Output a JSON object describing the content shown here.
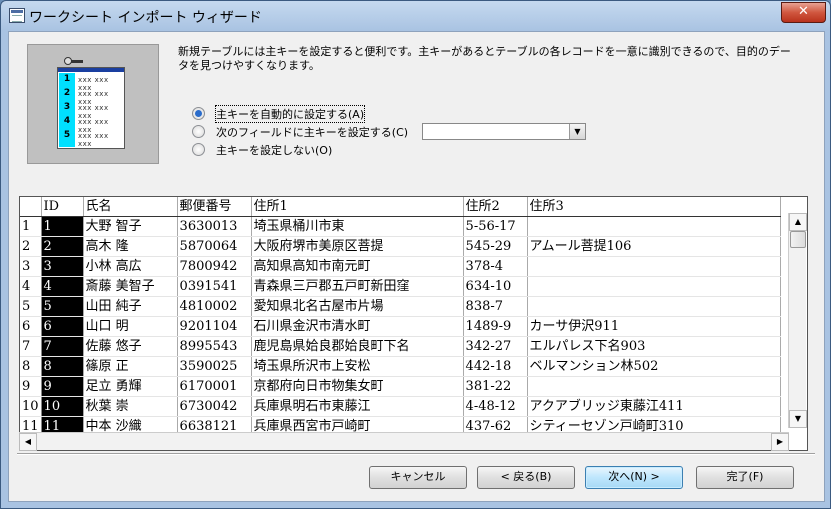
{
  "window": {
    "title": "ワークシート インポート ウィザード",
    "close_glyph": "✕"
  },
  "illustration": {
    "rows": [
      "1",
      "2",
      "3",
      "4",
      "5"
    ],
    "placeholder": "xxx xxx xxx"
  },
  "description": "新規テーブルには主キーを設定すると便利です。主キーがあるとテーブルの各レコードを一意に識別できるので、目的のデータを見つけやすくなります。",
  "options": [
    {
      "label": "主キーを自動的に設定する(A)",
      "checked": true
    },
    {
      "label": "次のフィールドに主キーを設定する(C)",
      "checked": false
    },
    {
      "label": "主キーを設定しない(O)",
      "checked": false
    }
  ],
  "field_combo": {
    "value": ""
  },
  "table": {
    "columns": [
      "",
      "ID",
      "氏名",
      "郵便番号",
      "住所1",
      "住所2",
      "住所3"
    ],
    "rows": [
      [
        "1",
        "1",
        "大野 智子",
        "3630013",
        "埼玉県桶川市東",
        "5-56-17",
        ""
      ],
      [
        "2",
        "2",
        "高木 隆",
        "5870064",
        "大阪府堺市美原区菩提",
        "545-29",
        "アムール菩提106"
      ],
      [
        "3",
        "3",
        "小林 高広",
        "7800942",
        "高知県高知市南元町",
        "378-4",
        ""
      ],
      [
        "4",
        "4",
        "斎藤 美智子",
        "0391541",
        "青森県三戸郡五戸町新田窪",
        "634-10",
        ""
      ],
      [
        "5",
        "5",
        "山田 純子",
        "4810002",
        "愛知県北名古屋市片場",
        "838-7",
        ""
      ],
      [
        "6",
        "6",
        "山口 明",
        "9201104",
        "石川県金沢市清水町",
        "1489-9",
        "カーサ伊沢911"
      ],
      [
        "7",
        "7",
        "佐藤 悠子",
        "8995543",
        "鹿児島県姶良郡姶良町下名",
        "342-27",
        "エルパレス下名903"
      ],
      [
        "8",
        "8",
        "篠原 正",
        "3590025",
        "埼玉県所沢市上安松",
        "442-18",
        "ベルマンション林502"
      ],
      [
        "9",
        "9",
        "足立 勇輝",
        "6170001",
        "京都府向日市物集女町",
        "381-22",
        ""
      ],
      [
        "10",
        "10",
        "秋葉 崇",
        "6730042",
        "兵庫県明石市東藤江",
        "4-48-12",
        "アクアブリッジ東藤江411"
      ],
      [
        "11",
        "11",
        "中本 沙織",
        "6638121",
        "兵庫県西宮市戸崎町",
        "437-62",
        "シティーセゾン戸崎町310"
      ]
    ]
  },
  "buttons": {
    "cancel": "キャンセル",
    "back": "< 戻る(B)",
    "next": "次へ(N) >",
    "finish": "完了(F)"
  },
  "scroll_glyphs": {
    "up": "▲",
    "down": "▼",
    "left": "◀",
    "right": "▶",
    "dropdown": "▼"
  }
}
